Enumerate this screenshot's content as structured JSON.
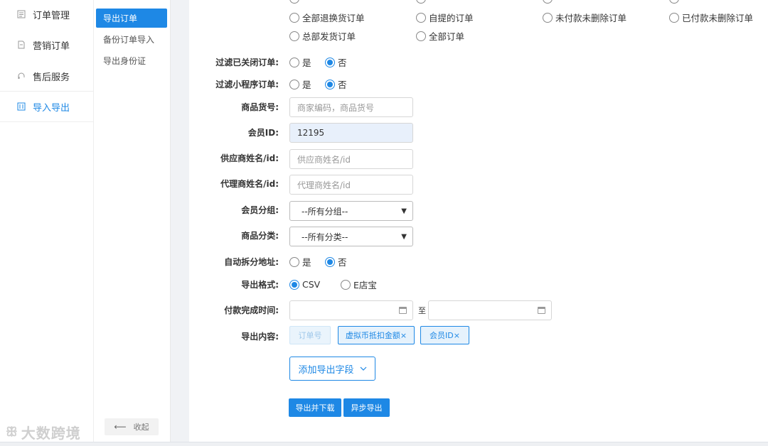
{
  "sidebar": {
    "items": [
      {
        "label": "订单管理",
        "icon": "list-icon"
      },
      {
        "label": "营销订单",
        "icon": "document-icon"
      },
      {
        "label": "售后服务",
        "icon": "headset-icon"
      },
      {
        "label": "导入导出",
        "icon": "import-export-icon",
        "active": true
      }
    ]
  },
  "subnav": {
    "items": [
      {
        "label": "导出订单",
        "active": true
      },
      {
        "label": "备份订单导入"
      },
      {
        "label": "导出身份证"
      }
    ],
    "collapse_label": "收起"
  },
  "status_options": {
    "row1": [
      "全部退换货订单",
      "自提的订单",
      "未付款未删除订单",
      "已付款未删除订单"
    ],
    "row2": [
      "总部发货订单",
      "全部订单"
    ]
  },
  "form": {
    "filter_closed": {
      "label": "过滤已关闭订单:",
      "yes": "是",
      "no": "否",
      "value": "否"
    },
    "filter_miniprogram": {
      "label": "过滤小程序订单:",
      "yes": "是",
      "no": "否",
      "value": "否"
    },
    "product_code": {
      "label": "商品货号:",
      "placeholder": "商家编码，商品货号"
    },
    "member_id": {
      "label": "会员ID:",
      "value": "12195"
    },
    "supplier": {
      "label": "供应商姓名/id:",
      "placeholder": "供应商姓名/id"
    },
    "agent": {
      "label": "代理商姓名/id:",
      "placeholder": "代理商姓名/id"
    },
    "member_group": {
      "label": "会员分组:",
      "selected": "--所有分组--"
    },
    "product_category": {
      "label": "商品分类:",
      "selected": "--所有分类--"
    },
    "auto_split": {
      "label": "自动拆分地址:",
      "yes": "是",
      "no": "否",
      "value": "否"
    },
    "export_format": {
      "label": "导出格式:",
      "options": [
        "CSV",
        "E店宝"
      ],
      "value": "CSV"
    },
    "payment_time": {
      "label": "付款完成时间:",
      "separator": "至"
    },
    "export_content": {
      "label": "导出内容:",
      "tags": [
        {
          "text": "订单号",
          "disabled": true
        },
        {
          "text": "虚拟币抵扣金额×"
        },
        {
          "text": "会员ID×"
        }
      ]
    },
    "add_field_label": "添加导出字段",
    "export_download_label": "导出并下载",
    "async_export_label": "异步导出"
  },
  "watermark": "大数跨境",
  "colors": {
    "accent": "#1e88e5"
  }
}
